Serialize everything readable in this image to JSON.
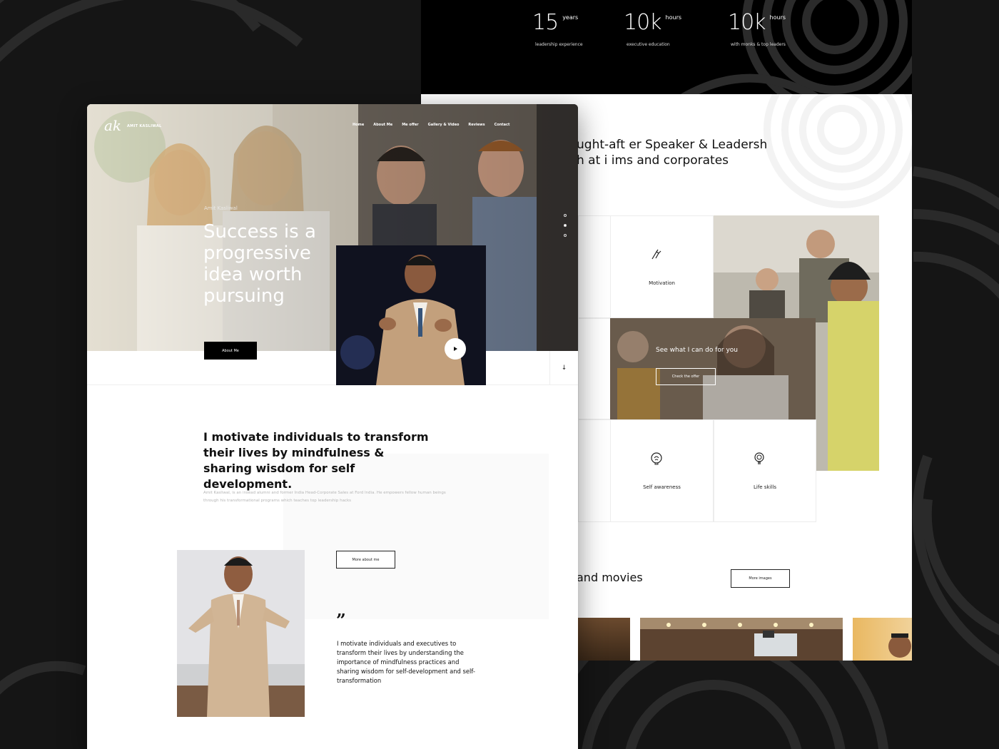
{
  "colors": {
    "background": "#151515",
    "ink": "#111111",
    "white": "#ffffff"
  },
  "stats": [
    {
      "value": "15",
      "unit": "years",
      "label": "leadership experience"
    },
    {
      "value": "10k",
      "unit": "hours",
      "label": "executive education"
    },
    {
      "value": "10k",
      "unit": "hours",
      "label": "with monks & top leaders"
    }
  ],
  "back": {
    "heading_line1": "ught-aft er Speaker & Leadersh",
    "heading_line2": "h at i ims and corporates",
    "services": [
      {
        "label": "Motivation",
        "icon": "hand-icon"
      },
      {
        "label": "Self awareness",
        "icon": "brain-icon"
      },
      {
        "label": "Life skills",
        "icon": "lightbulb-icon"
      }
    ],
    "offer_title": "See what I can do for you",
    "offer_button": "Check the offer",
    "gallery_heading": "and movies",
    "more_images": "More images"
  },
  "front": {
    "logo_mark": "ak",
    "logo_text": "AMIT KASLIWAL",
    "nav": [
      "Home",
      "About Me",
      "Me offer",
      "Gallery & Video",
      "Reviews",
      "Contact"
    ],
    "hero_eyebrow": "Amit Kasliwal",
    "hero_title": "Success is a progressive idea worth pursuing",
    "about_button": "About Me",
    "scroll_arrow": "↓",
    "intro_heading": "I motivate individuals to transform their lives by mindfulness & sharing wisdom for self development.",
    "intro_body": "Amit Kasliwal, is an insead alumni and former India Head-Corporate Sales at Ford India. He empowers fellow human beings through his transformational programs which teaches top leadership hacks",
    "more_about": "More about me",
    "quote_mark": "”",
    "quote": "I motivate individuals and executives to transform their lives by understanding the importance of mindfulness practices and sharing wisdom for self-development and self-transformation"
  }
}
